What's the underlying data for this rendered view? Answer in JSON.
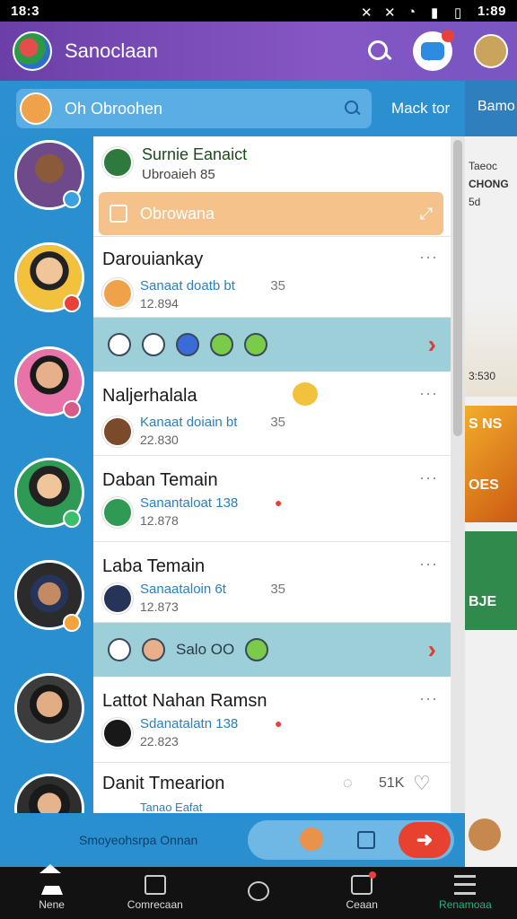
{
  "status": {
    "time_left": "18:3",
    "time_right": "1:89"
  },
  "appbar": {
    "title": "Sanoclaan"
  },
  "search": {
    "placeholder": "Oh Obroohen",
    "link": "Mack tor"
  },
  "right_panel": {
    "tab": "Bamo",
    "line1": "Taeoc",
    "line2": "CHONG",
    "line3": "5d",
    "line4": "3:530",
    "label1": "S NS",
    "label2": "OES",
    "label3": "BJE"
  },
  "chats": [
    {
      "name": "Surnie Eanaict",
      "sub": "Ubroaieh 85 ",
      "promo": "Obrowana"
    },
    {
      "name": "Darouiankay",
      "sub": "Sanaat doatb bt",
      "count": "35",
      "time": "12.894"
    },
    {
      "name": "Naljerhalala",
      "sub": "Kanaat doiain bt",
      "count": "35",
      "time": "22.830"
    },
    {
      "name": "Daban Temain",
      "sub": "Sanantaloat 138",
      "time": "12.878"
    },
    {
      "name": "Laba Temain",
      "sub": "Sanaataloin 6t",
      "count": "35",
      "time": "12.873"
    },
    {
      "name": "Lattot Nahan Ramsn",
      "sub": "Sdanatalatn 138",
      "time": "22.823"
    },
    {
      "name": "Danit Tmearion",
      "sub": "Tanao Eafat",
      "count": "51K"
    }
  ],
  "band2_text": "Salo OO",
  "compose": {
    "hint": "Smoyeohsrpa Onnan"
  },
  "nav": [
    {
      "label": "Nene",
      "icon": "home-icon"
    },
    {
      "label": "Comrecaan",
      "icon": "gallery-icon"
    },
    {
      "label": "",
      "icon": "circle-icon"
    },
    {
      "label": "Ceaan",
      "icon": "camera-icon"
    },
    {
      "label": "Renamoaa",
      "icon": "menu-icon"
    }
  ],
  "colors": {
    "appbar": "#7b55c2",
    "accent_blue": "#2a8fcf",
    "send": "#e8412f",
    "band": "#9ccfd7",
    "promo": "#f6c28c"
  }
}
